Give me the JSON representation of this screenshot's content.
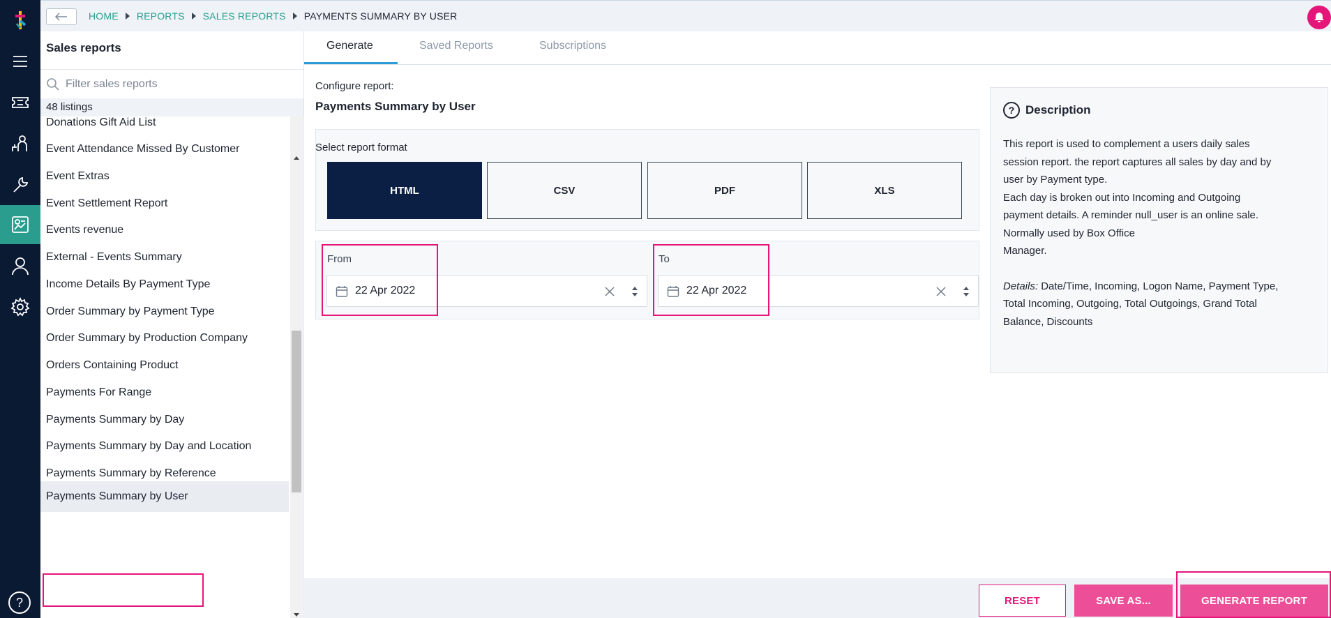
{
  "rail": {
    "items": [
      "menu-icon",
      "ticket-icon",
      "user-connect-icon",
      "wrench-icon",
      "report-icon",
      "person-icon",
      "gear-icon"
    ],
    "active": "report-icon",
    "help": "?"
  },
  "breadcrumb": {
    "items": [
      "HOME",
      "REPORTS",
      "SALES REPORTS",
      "PAYMENTS SUMMARY BY USER"
    ]
  },
  "sidebar": {
    "title": "Sales reports",
    "search_placeholder": "Filter sales reports",
    "count": "48 listings",
    "items": [
      "Donations Gift Aid List",
      "Event Attendance Missed By Customer",
      "Event Extras",
      "Event Settlement Report",
      "Events revenue",
      "External - Events Summary",
      "Income Details By Payment Type",
      "Order Summary by Payment Type",
      "Order Summary by Production Company",
      "Orders Containing Product",
      "Payments For Range",
      "Payments Summary by Day",
      "Payments Summary by Day and Location",
      "Payments Summary by Reference",
      "Payments Summary by User"
    ],
    "selected": "Payments Summary by User"
  },
  "tabs": [
    "Generate",
    "Saved Reports",
    "Subscriptions"
  ],
  "config": {
    "label": "Configure report:",
    "title": "Payments Summary by User",
    "format_label": "Select report format",
    "formats": [
      "HTML",
      "CSV",
      "PDF",
      "XLS"
    ],
    "selected_format": "HTML",
    "from_label": "From",
    "from_value": "22 Apr 2022",
    "to_label": "To",
    "to_value": "22 Apr 2022"
  },
  "description": {
    "title": "Description",
    "line1": "This report is used to complement a users daily sales",
    "line2": "session report. the report captures all sales by day and by",
    "line3": "user by Payment type.",
    "line4": "Each day is broken out into Incoming and Outgoing",
    "line5": "payment details. A reminder null_user is an online sale.",
    "line6": "Normally used by Box Office",
    "line7": "Manager.",
    "details_label": "Details:",
    "details1": "Date/Time, Incoming, Logon Name, Payment Type,",
    "details2": "Total Incoming, Outgoing, Total Outgoings, Grand Total",
    "details3": "Balance, Discounts"
  },
  "footer": {
    "reset": "RESET",
    "save": "SAVE AS...",
    "generate": "GENERATE REPORT"
  },
  "colors": {
    "rail": "#0b1a33",
    "accent_teal": "#2a9d8f",
    "brand_pink": "#e5157a",
    "button_pink": "#ec4f97",
    "format_active": "#0b1f45"
  }
}
